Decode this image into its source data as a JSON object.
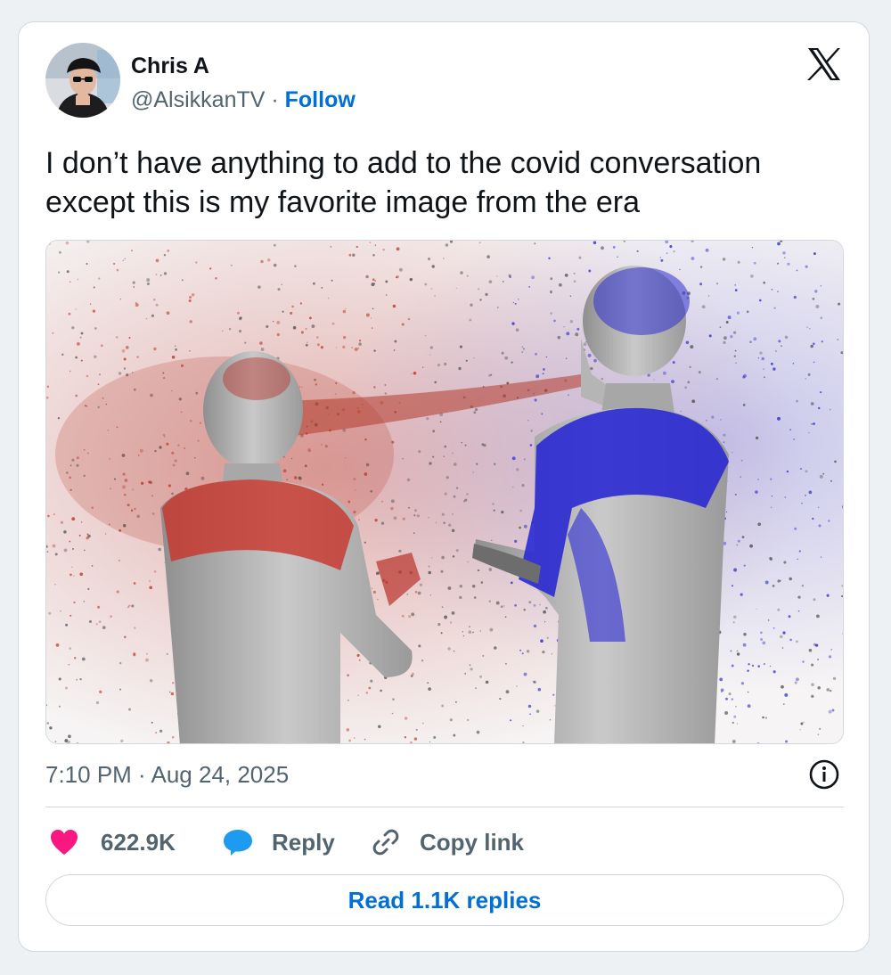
{
  "author": {
    "display_name": "Chris A",
    "handle": "@AlsikkanTV",
    "separator": " · ",
    "follow_label": "Follow"
  },
  "tweet": {
    "text": "I don’t have anything to add to the covid conversation except this is my favorite image from the era",
    "timestamp": "7:10 PM · Aug 24, 2025"
  },
  "actions": {
    "likes": "622.9K",
    "reply_label": "Reply",
    "copy_link_label": "Copy link"
  },
  "read_replies_label": "Read 1.1K replies",
  "icons": {
    "platform": "x-logo-icon",
    "like": "heart-icon",
    "reply": "speech-bubble-icon",
    "copy": "link-icon",
    "info": "info-icon"
  },
  "colors": {
    "accent": "#006fd6",
    "like": "#f91880",
    "reply": "#1d9bf0",
    "muted": "#536471",
    "border": "#cfd9de",
    "text": "#0f1419",
    "particle_red": "#c0392b",
    "particle_blue": "#2c2ccf"
  }
}
